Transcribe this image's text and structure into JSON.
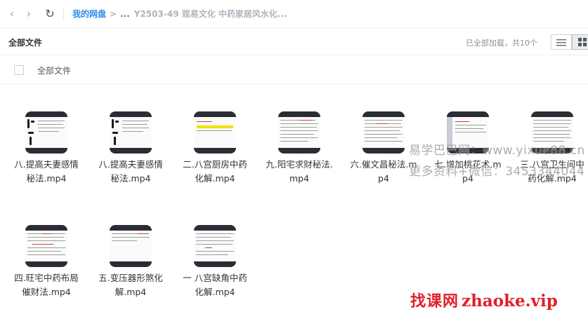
{
  "nav": {
    "back_icon": "‹",
    "forward_icon": "›",
    "refresh_icon": "↻"
  },
  "breadcrumb": {
    "root": "我的网盘",
    "separator": ">",
    "ellipsis": "...",
    "current": "Y2503-49 观易文化 中药家居风水化..."
  },
  "header": {
    "title": "全部文件",
    "load_status": "已全部加载，共10个"
  },
  "select": {
    "label": "全部文件"
  },
  "files": [
    {
      "name": "八.提高夫妻感情秘法.mp4"
    },
    {
      "name": "八.提高夫妻感情秘法.mp4"
    },
    {
      "name": "二.八宫厨房中药化解.mp4"
    },
    {
      "name": "九.阳宅求财秘法.mp4"
    },
    {
      "name": "六.催文昌秘法.mp4"
    },
    {
      "name": "七.增加桃花术.mp4"
    },
    {
      "name": "三.八宫卫生间中药化解.mp4"
    },
    {
      "name": "四.旺宅中药布局催财法.mp4"
    },
    {
      "name": "五.变压器形煞化解.mp4"
    },
    {
      "name": "一 八宫缺角中药化解.mp4"
    }
  ],
  "watermark": {
    "line1": "易学巴巴网：www.yixue88.cn",
    "line2": "更多资料+微信：3453344044"
  },
  "brand": {
    "cn": "找课网",
    "en": "zhaoke.vip"
  },
  "colors": {
    "accent": "#2d8cf0",
    "brand_red": "#e0202a",
    "thumb_bg": "#2b2d35"
  }
}
